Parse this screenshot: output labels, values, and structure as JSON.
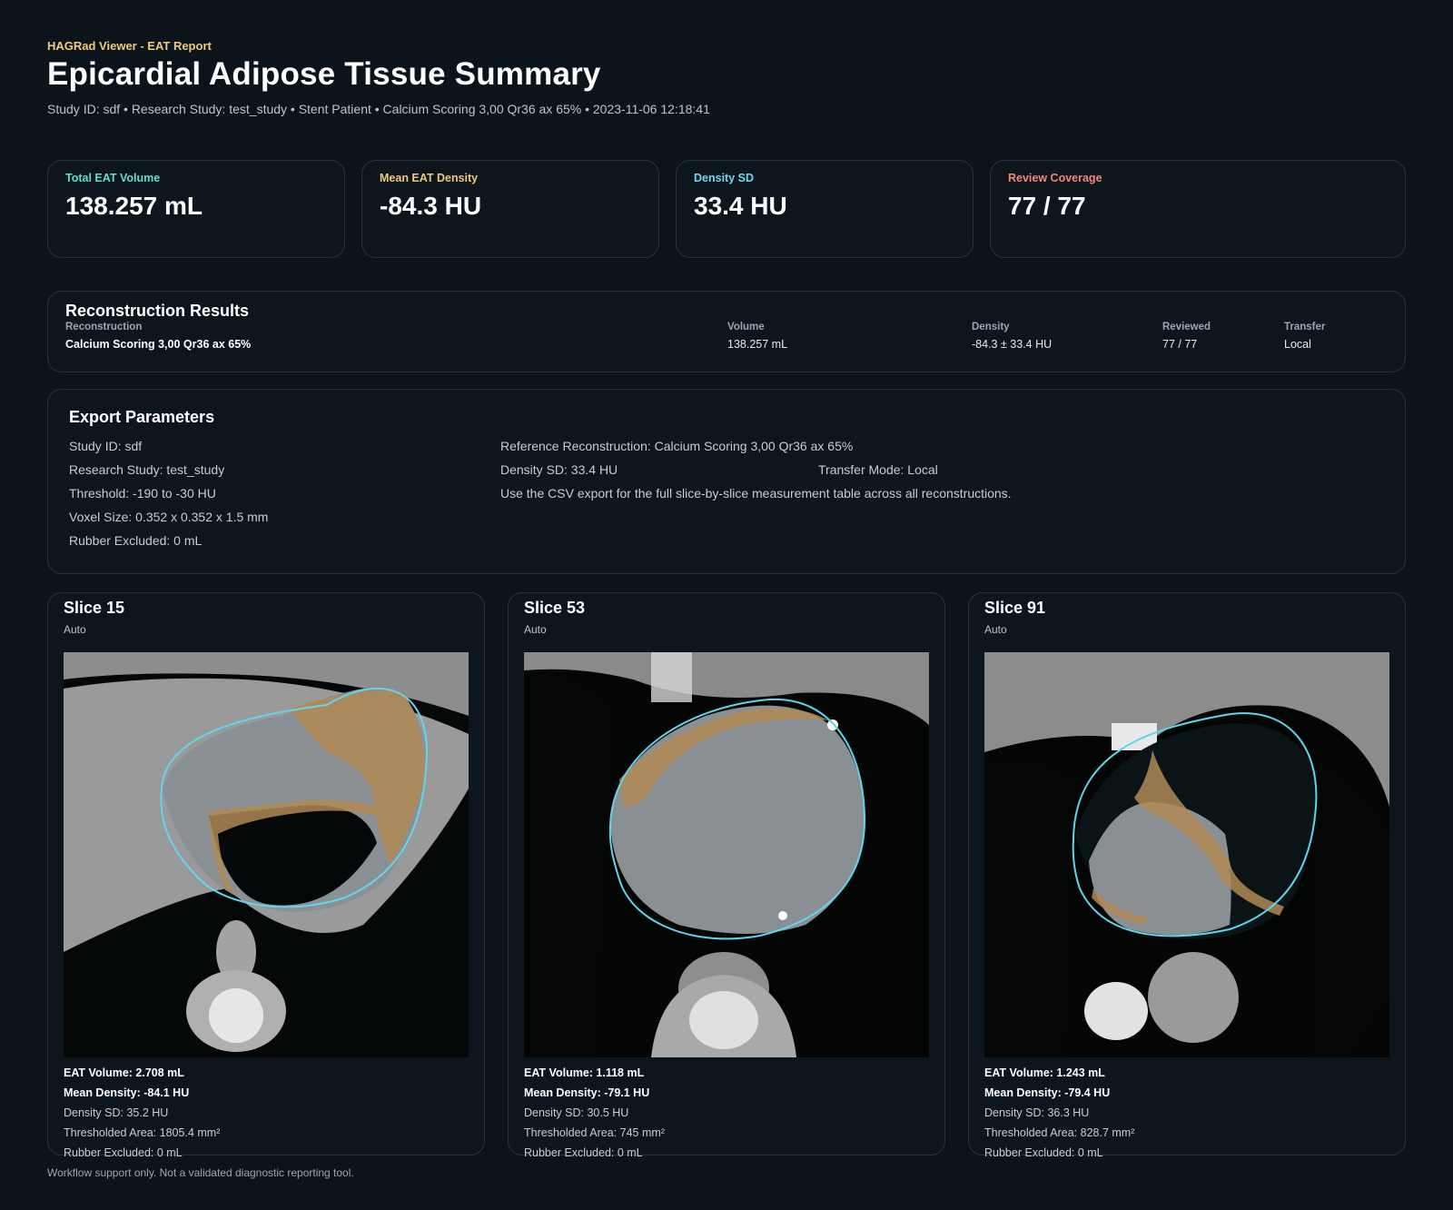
{
  "header": {
    "app_label": "HAGRad Viewer - EAT Report",
    "title": "Epicardial Adipose Tissue Summary",
    "subtitle": "Study ID: sdf • Research Study: test_study • Stent Patient • Calcium Scoring 3,00 Qr36 ax 65% • 2023-11-06 12:18:41"
  },
  "stats": [
    {
      "label": "Total EAT Volume",
      "value": "138.257 mL",
      "color": "#5fe0c9"
    },
    {
      "label": "Mean EAT Density",
      "value": "-84.3 HU",
      "color": "#f2c879"
    },
    {
      "label": "Density SD",
      "value": "33.4 HU",
      "color": "#6fd8f2"
    },
    {
      "label": "Review Coverage",
      "value": "77 / 77",
      "color": "#f2877a"
    }
  ],
  "recon": {
    "title": "Reconstruction Results",
    "headers": {
      "reconstruction": "Reconstruction",
      "volume": "Volume",
      "density": "Density",
      "reviewed": "Reviewed",
      "transfer": "Transfer"
    },
    "row": {
      "reconstruction": "Calcium Scoring 3,00 Qr36 ax 65%",
      "volume": "138.257 mL",
      "density": "-84.3 ± 33.4 HU",
      "reviewed": "77 / 77",
      "transfer": "Local"
    }
  },
  "export": {
    "title": "Export Parameters",
    "study_id": "Study ID: sdf",
    "research_study": "Research Study: test_study",
    "threshold": "Threshold: -190 to -30 HU",
    "voxel_size": "Voxel Size: 0.352 x 0.352 x 1.5 mm",
    "rubber_excluded": "Rubber Excluded: 0 mL",
    "reference_recon": "Reference Reconstruction: Calcium Scoring 3,00 Qr36 ax 65%",
    "density_sd": "Density SD: 33.4 HU",
    "transfer_mode": "Transfer Mode: Local",
    "csv_note": "Use the CSV export for the full slice-by-slice measurement table across all reconstructions."
  },
  "slices": [
    {
      "title": "Slice 15",
      "mode": "Auto",
      "eat_volume": "EAT Volume: 2.708 mL",
      "mean_density": "Mean Density: -84.1 HU",
      "density_sd": "Density SD: 35.2 HU",
      "area": "Thresholded Area: 1805.4 mm²",
      "rubber": "Rubber Excluded: 0 mL"
    },
    {
      "title": "Slice 53",
      "mode": "Auto",
      "eat_volume": "EAT Volume: 1.118 mL",
      "mean_density": "Mean Density: -79.1 HU",
      "density_sd": "Density SD: 30.5 HU",
      "area": "Thresholded Area: 745 mm²",
      "rubber": "Rubber Excluded: 0 mL"
    },
    {
      "title": "Slice 91",
      "mode": "Auto",
      "eat_volume": "EAT Volume: 1.243 mL",
      "mean_density": "Mean Density: -79.4 HU",
      "density_sd": "Density SD: 36.3 HU",
      "area": "Thresholded Area: 828.7 mm²",
      "rubber": "Rubber Excluded: 0 mL"
    }
  ],
  "colors": {
    "contour": "#5fd6ee",
    "fat_overlay": "#b08a55"
  },
  "footer": "Workflow support only. Not a validated diagnostic reporting tool."
}
